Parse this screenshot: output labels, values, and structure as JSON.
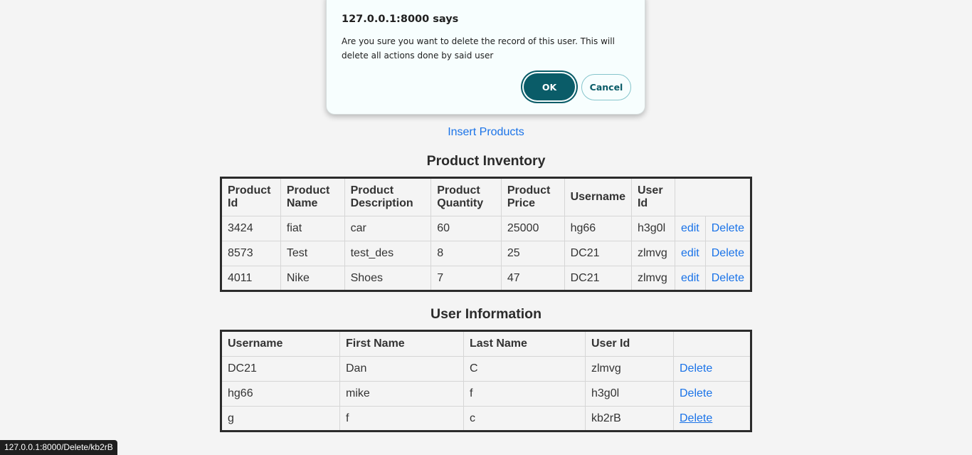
{
  "dialog": {
    "title": "127.0.0.1:8000 says",
    "message": "Are you sure you want to delete the record of this user. This will delete all actions done by said user",
    "ok_label": "OK",
    "cancel_label": "Cancel"
  },
  "insert_link": "Insert Products",
  "product_inventory": {
    "title": "Product Inventory",
    "headers": [
      "Product Id",
      "Product Name",
      "Product Description",
      "Product Quantity",
      "Product Price",
      "Username",
      "User Id",
      ""
    ],
    "edit_label": "edit",
    "delete_label": "Delete",
    "rows": [
      {
        "id": "3424",
        "name": "fiat",
        "description": "car",
        "quantity": "60",
        "price": "25000",
        "username": "hg66",
        "user_id": "h3g0l"
      },
      {
        "id": "8573",
        "name": "Test",
        "description": "test_des",
        "quantity": "8",
        "price": "25",
        "username": "DC21",
        "user_id": "zlmvg"
      },
      {
        "id": "4011",
        "name": "Nike",
        "description": "Shoes",
        "quantity": "7",
        "price": "47",
        "username": "DC21",
        "user_id": "zlmvg"
      }
    ]
  },
  "user_information": {
    "title": "User Information",
    "headers": [
      "Username",
      "First Name",
      "Last Name",
      "User Id",
      ""
    ],
    "delete_label": "Delete",
    "rows": [
      {
        "username": "DC21",
        "first_name": "Dan",
        "last_name": "C",
        "user_id": "zlmvg"
      },
      {
        "username": "hg66",
        "first_name": "mike",
        "last_name": "f",
        "user_id": "h3g0l"
      },
      {
        "username": "g",
        "first_name": "f",
        "last_name": "c",
        "user_id": "kb2rB"
      }
    ]
  },
  "status_bar": "127.0.0.1:8000/Delete/kb2rB",
  "colors": {
    "link": "#1a73e8",
    "ok_button": "#0a5c68"
  }
}
